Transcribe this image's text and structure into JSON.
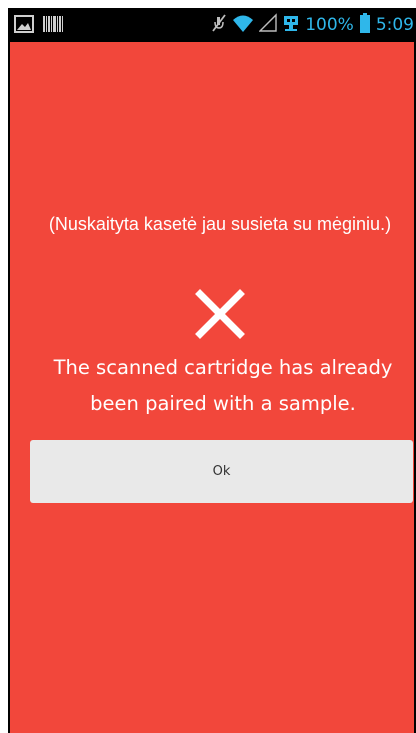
{
  "status_bar": {
    "battery_percent": "100%",
    "time": "5:09",
    "icons": [
      "gallery-icon",
      "barcode-icon",
      "mute-icon",
      "wifi-icon",
      "signal-icon",
      "usb-icon",
      "battery-icon"
    ],
    "accent_color": "#2fb7ea"
  },
  "dialog": {
    "background_color": "#f2473b",
    "message_lt": "(Nuskaityta kasetė jau susieta su mėginiu.)",
    "icon": "close-x-icon",
    "message_en": "The scanned cartridge has already been paired with a sample.",
    "ok_label": "Ok"
  }
}
